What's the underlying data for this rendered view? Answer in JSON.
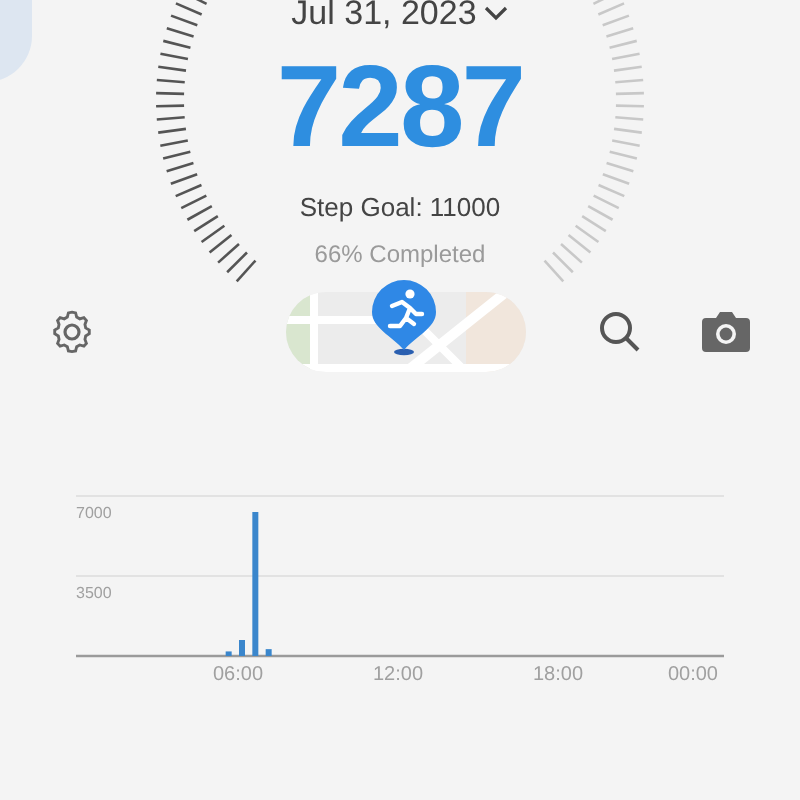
{
  "date": "Jul 31, 2023",
  "steps": "7287",
  "goal": "Step Goal: 11000",
  "completed": "66% Completed",
  "chart": {
    "chart_data": {
      "type": "bar",
      "x": [
        5.5,
        6,
        6.5,
        7
      ],
      "series": [
        {
          "color": "#3a86cc",
          "values": [
            200,
            700,
            6300,
            300
          ]
        }
      ],
      "xlim": [
        0,
        24
      ],
      "ylim": [
        0,
        7000
      ],
      "yticks": [
        3500,
        7000
      ],
      "xticks": [
        {
          "value": 6,
          "label": "06:00"
        },
        {
          "value": 12,
          "label": "12:00"
        },
        {
          "value": 18,
          "label": "18:00"
        },
        {
          "value": 24,
          "label": "00:00"
        }
      ]
    }
  }
}
